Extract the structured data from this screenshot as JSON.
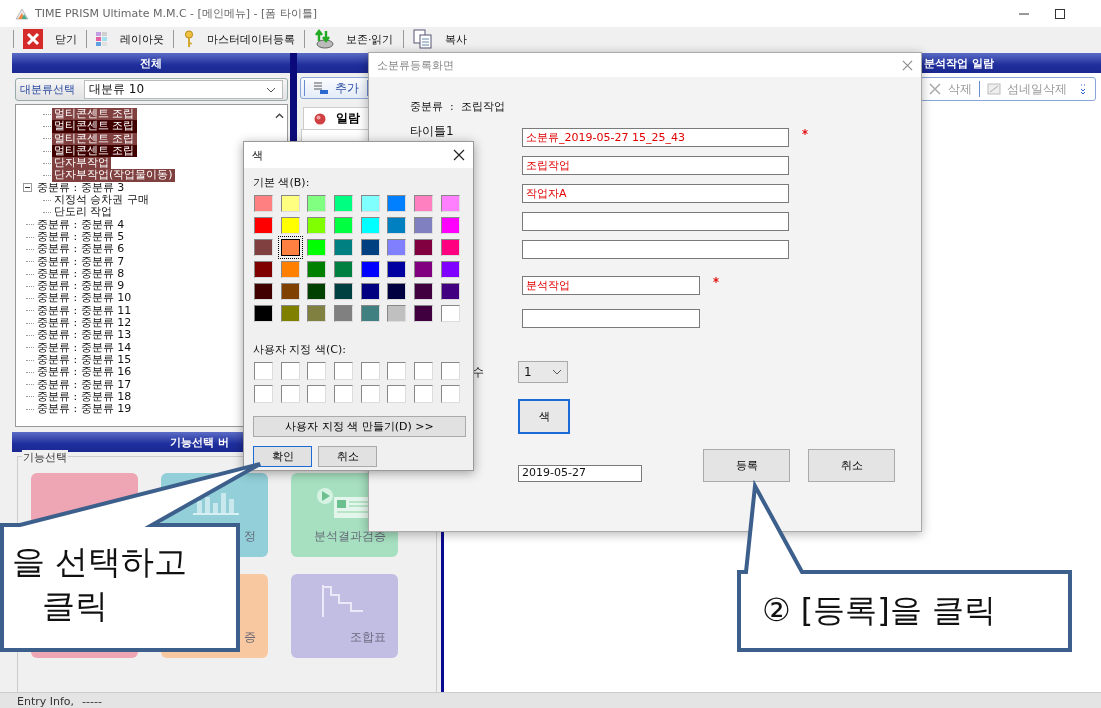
{
  "window": {
    "title": "TIME PRISM Ultimate M.M.C - [메인메뉴] - [폼 타이틀]"
  },
  "toolbar": [
    {
      "label": "닫기",
      "kind": "close"
    },
    {
      "label": "레이아웃",
      "kind": "layout"
    },
    {
      "label": "마스터데이터등록",
      "kind": "key"
    },
    {
      "label": "보존·읽기",
      "kind": "save"
    },
    {
      "label": "복사",
      "kind": "copy"
    }
  ],
  "left_panel": {
    "header": "전체",
    "filter_label": "대분류선택",
    "filter_value": "대분류 10",
    "tree": [
      {
        "children": [
          {
            "label": "멀티콘센트 조립",
            "color": "#804040"
          },
          {
            "label": "멀티콘센트 조립",
            "color": "#400000"
          },
          {
            "label": "멀티콘센트 조립",
            "color": "#804040"
          },
          {
            "label": "멀티콘센트 조립",
            "color": "#400000"
          },
          {
            "label": "단자부작업",
            "color": "#804040"
          },
          {
            "label": "단자부작업(작업물이동)",
            "color": "#804040"
          }
        ]
      },
      {
        "label": "중분류 : 중분류 3",
        "expanded": true,
        "children": [
          {
            "label": "지정석 승차권 구매"
          },
          {
            "label": "단도리 작업"
          }
        ]
      },
      {
        "label": "중분류 : 중분류 4"
      },
      {
        "label": "중분류 : 중분류 5"
      },
      {
        "label": "중분류 : 중분류 6"
      },
      {
        "label": "중분류 : 중분류 7"
      },
      {
        "label": "중분류 : 중분류 8"
      },
      {
        "label": "중분류 : 중분류 9"
      },
      {
        "label": "중분류 : 중분류 10"
      },
      {
        "label": "중분류 : 중분류 11"
      },
      {
        "label": "중분류 : 중분류 12"
      },
      {
        "label": "중분류 : 중분류 13"
      },
      {
        "label": "중분류 : 중분류 14"
      },
      {
        "label": "중분류 : 중분류 15"
      },
      {
        "label": "중분류 : 중분류 16"
      },
      {
        "label": "중분류 : 중분류 17"
      },
      {
        "label": "중분류 : 중분류 18"
      },
      {
        "label": "중분류 : 중분류 19"
      }
    ]
  },
  "middle_panel": {
    "add_button": "추가",
    "tab": "일람"
  },
  "right_panel": {
    "header": "분석작업 일람",
    "buttons": [
      {
        "label": "삭제",
        "disabled": true
      },
      {
        "label": "섬네일삭제",
        "disabled": true
      }
    ]
  },
  "function_panel": {
    "header": "기능선택 버",
    "group_label": "기능선택",
    "tiles": [
      {
        "kind": "blank",
        "color": "#eea6b4"
      },
      {
        "kind": "chart",
        "color": "#92cfd8",
        "label": "정"
      },
      {
        "kind": "media",
        "color": "#a6e0c0",
        "label": "분석결과검증"
      },
      {
        "kind": "blank",
        "color": "#eea6b4"
      },
      {
        "kind": "blank",
        "color": "#f8c8a0",
        "label": "증"
      },
      {
        "kind": "steps",
        "color": "#c2bde2",
        "label": "조합표"
      }
    ]
  },
  "status_bar": {
    "label": "Entry Info,",
    "value": "-----"
  },
  "register_dialog": {
    "title": "소분류등록화면",
    "category": "중분류  :  조립작업",
    "title_label": "타이틀1",
    "title_fields": [
      {
        "value": "소분류_2019-05-27 15_25_43",
        "required": true
      },
      {
        "value": "조립작업",
        "required": false
      },
      {
        "value": "작업자A",
        "required": false
      },
      {
        "required": false
      },
      {
        "required": false
      }
    ],
    "work_fields": [
      {
        "value": "분석작업",
        "required": true
      },
      {
        "required": false
      }
    ],
    "count_label": "수",
    "count_value": "1",
    "color_button": "색",
    "date_value": "2019-05-27",
    "buttons": [
      "등록",
      "취소"
    ]
  },
  "color_dialog": {
    "title": "색",
    "basic_label": "기본 색(B):",
    "basic_colors": [
      {
        "color": "#ff8080",
        "selected": false
      },
      {
        "color": "#ffff80",
        "selected": false
      },
      {
        "color": "#80ff80",
        "selected": false
      },
      {
        "color": "#00ff80",
        "selected": false
      },
      {
        "color": "#80ffff",
        "selected": false
      },
      {
        "color": "#0080ff",
        "selected": false
      },
      {
        "color": "#ff80c0",
        "selected": false
      },
      {
        "color": "#ff80ff",
        "selected": false
      },
      {
        "color": "#ff0000",
        "selected": false
      },
      {
        "color": "#ffff00",
        "selected": false
      },
      {
        "color": "#80ff00",
        "selected": false
      },
      {
        "color": "#00ff40",
        "selected": false
      },
      {
        "color": "#00ffff",
        "selected": false
      },
      {
        "color": "#0080c0",
        "selected": false
      },
      {
        "color": "#8080c0",
        "selected": false
      },
      {
        "color": "#ff00ff",
        "selected": false
      },
      {
        "color": "#804040",
        "selected": false
      },
      {
        "color": "#ff8040",
        "selected": true
      },
      {
        "color": "#00ff00",
        "selected": false
      },
      {
        "color": "#008080",
        "selected": false
      },
      {
        "color": "#004080",
        "selected": false
      },
      {
        "color": "#8080ff",
        "selected": false
      },
      {
        "color": "#800040",
        "selected": false
      },
      {
        "color": "#ff0080",
        "selected": false
      },
      {
        "color": "#800000",
        "selected": false
      },
      {
        "color": "#ff8000",
        "selected": false
      },
      {
        "color": "#008000",
        "selected": false
      },
      {
        "color": "#008040",
        "selected": false
      },
      {
        "color": "#0000ff",
        "selected": false
      },
      {
        "color": "#0000a0",
        "selected": false
      },
      {
        "color": "#800080",
        "selected": false
      },
      {
        "color": "#8000ff",
        "selected": false
      },
      {
        "color": "#400000",
        "selected": false
      },
      {
        "color": "#804000",
        "selected": false
      },
      {
        "color": "#004000",
        "selected": false
      },
      {
        "color": "#004040",
        "selected": false
      },
      {
        "color": "#000080",
        "selected": false
      },
      {
        "color": "#000040",
        "selected": false
      },
      {
        "color": "#400040",
        "selected": false
      },
      {
        "color": "#400080",
        "selected": false
      },
      {
        "color": "#000000",
        "selected": false
      },
      {
        "color": "#808000",
        "selected": false
      },
      {
        "color": "#808040",
        "selected": false
      },
      {
        "color": "#808080",
        "selected": false
      },
      {
        "color": "#408080",
        "selected": false
      },
      {
        "color": "#c0c0c0",
        "selected": false
      },
      {
        "color": "#400040",
        "selected": false
      },
      {
        "color": "#ffffff",
        "selected": false
      }
    ],
    "custom_label": "사용자 지정 색(C):",
    "custom_colors": [
      {
        "color": "#ffffff"
      },
      {
        "color": "#ffffff"
      },
      {
        "color": "#ffffff"
      },
      {
        "color": "#ffffff"
      },
      {
        "color": "#ffffff"
      },
      {
        "color": "#ffffff"
      },
      {
        "color": "#ffffff"
      },
      {
        "color": "#ffffff"
      },
      {
        "color": "#ffffff"
      },
      {
        "color": "#ffffff"
      },
      {
        "color": "#ffffff"
      },
      {
        "color": "#ffffff"
      },
      {
        "color": "#ffffff"
      },
      {
        "color": "#ffffff"
      },
      {
        "color": "#ffffff"
      },
      {
        "color": "#ffffff"
      }
    ],
    "define_button": "사용자 지정 색 만들기(D) >>",
    "ok_button": "확인",
    "cancel_button": "취소"
  },
  "callouts": [
    {
      "lines": [
        "을 선택하고",
        "클릭"
      ]
    },
    {
      "lines": [
        "② [등록]을 클릭"
      ]
    }
  ]
}
